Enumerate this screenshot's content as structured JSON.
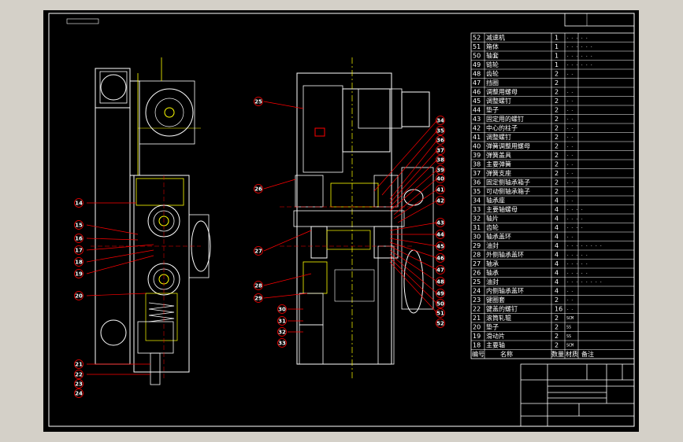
{
  "sheet": {
    "top_left_tag": "",
    "top_right_tag": ""
  },
  "bom": {
    "header": [
      "编号",
      "名称",
      "数量",
      "材质",
      "备注"
    ],
    "rows": [
      {
        "no": "52",
        "name": "减速机",
        "qty": "1",
        "spec": "- - - - -"
      },
      {
        "no": "51",
        "name": "箱体",
        "qty": "1",
        "spec": "- - - - - -"
      },
      {
        "no": "50",
        "name": "轴套",
        "qty": "1",
        "spec": "- - - - - -"
      },
      {
        "no": "49",
        "name": "链轮",
        "qty": "1",
        "spec": "- - - - - -"
      },
      {
        "no": "48",
        "name": "齿轮",
        "qty": "2",
        "spec": "- -"
      },
      {
        "no": "47",
        "name": "挡圈",
        "qty": "2",
        "spec": ""
      },
      {
        "no": "46",
        "name": "调整用螺母",
        "qty": "2",
        "spec": "- -"
      },
      {
        "no": "45",
        "name": "调整螺钉",
        "qty": "2",
        "spec": "- -"
      },
      {
        "no": "44",
        "name": "垫子",
        "qty": "2",
        "spec": "- -"
      },
      {
        "no": "43",
        "name": "固定用的螺钉",
        "qty": "2",
        "spec": "- -"
      },
      {
        "no": "42",
        "name": "中心的柱子",
        "qty": "2",
        "spec": "- -"
      },
      {
        "no": "41",
        "name": "调整螺钉",
        "qty": "2",
        "spec": "- -"
      },
      {
        "no": "40",
        "name": "弹簧调整用螺母",
        "qty": "2",
        "spec": "- -"
      },
      {
        "no": "39",
        "name": "弹簧盖具",
        "qty": "2",
        "spec": "- -"
      },
      {
        "no": "38",
        "name": "主要弹簧",
        "qty": "2",
        "spec": "- -"
      },
      {
        "no": "37",
        "name": "弹簧支座",
        "qty": "2",
        "spec": "- -"
      },
      {
        "no": "36",
        "name": "固定侧轴承箱子",
        "qty": "2",
        "spec": "- -"
      },
      {
        "no": "35",
        "name": "可动侧轴承箱子",
        "qty": "2",
        "spec": "- -"
      },
      {
        "no": "34",
        "name": "轴承座",
        "qty": "4",
        "spec": "- -"
      },
      {
        "no": "33",
        "name": "主要轴螺母",
        "qty": "4",
        "spec": "- - - -"
      },
      {
        "no": "32",
        "name": "轴片",
        "qty": "4",
        "spec": "- - - -"
      },
      {
        "no": "31",
        "name": "齿轮",
        "qty": "4",
        "spec": "- - - -"
      },
      {
        "no": "30",
        "name": "轴承盖环",
        "qty": "4",
        "spec": "- -"
      },
      {
        "no": "29",
        "name": "油封",
        "qty": "4",
        "spec": "- - - - - - - -"
      },
      {
        "no": "28",
        "name": "外侧轴承盖环",
        "qty": "4",
        "spec": "- - - - -"
      },
      {
        "no": "27",
        "name": "轴承",
        "qty": "4",
        "spec": "- - - - -"
      },
      {
        "no": "26",
        "name": "轴承",
        "qty": "4",
        "spec": "- - - - -"
      },
      {
        "no": "25",
        "name": "油封",
        "qty": "4",
        "spec": "- - - - - - - -"
      },
      {
        "no": "24",
        "name": "内侧轴承盖环",
        "qty": "4",
        "spec": "- -"
      },
      {
        "no": "23",
        "name": "键圈套",
        "qty": "2",
        "spec": "- -"
      },
      {
        "no": "22",
        "name": "键盖的螺钉",
        "qty": "16",
        "spec": "- -"
      },
      {
        "no": "21",
        "name": "滚筒轧辊",
        "qty": "2",
        "spec": "SCM"
      },
      {
        "no": "20",
        "name": "垫子",
        "qty": "2",
        "spec": "SS"
      },
      {
        "no": "19",
        "name": "滑动片",
        "qty": "2",
        "spec": "SS"
      },
      {
        "no": "18",
        "name": "主要轴",
        "qty": "2",
        "spec": "SCM"
      }
    ]
  },
  "title_block": {
    "company": "",
    "drawing_name": "",
    "scale": "",
    "sheet": ""
  },
  "callouts": {
    "left_view": [
      "14",
      "15",
      "16",
      "17",
      "18",
      "19",
      "20",
      "21",
      "22",
      "23",
      "24"
    ],
    "middle_left": [
      "25",
      "26",
      "27",
      "28",
      "29",
      "30",
      "31",
      "32",
      "33"
    ],
    "middle_right": [
      "34",
      "35",
      "36",
      "37",
      "38",
      "39",
      "40",
      "41",
      "42",
      "43",
      "44",
      "45",
      "46",
      "47",
      "48",
      "49",
      "50",
      "51",
      "52"
    ]
  }
}
